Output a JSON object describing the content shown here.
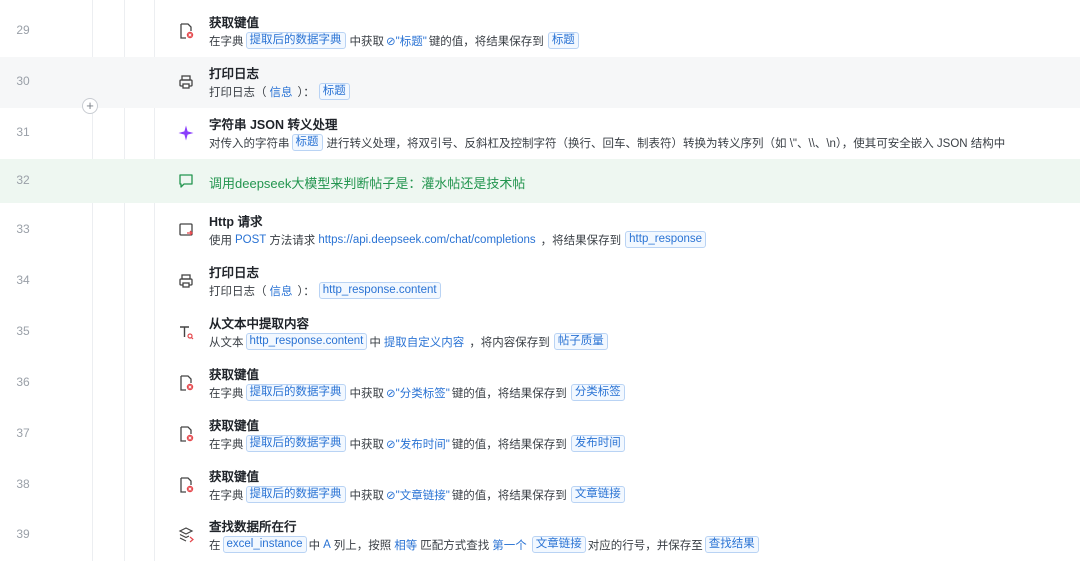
{
  "rows": [
    {
      "line": "29",
      "title": "获取键值",
      "desc": [
        "在字典",
        "提取后的数据字典",
        "中获取",
        "\"标题\"",
        "键的值，将结果保存到",
        "标题"
      ]
    },
    {
      "line": "30",
      "title": "打印日志",
      "desc": [
        "打印日志（",
        "信息",
        "）：",
        "标题"
      ]
    },
    {
      "line": "31",
      "title": "字符串 JSON 转义处理",
      "desc": [
        "对传入的字符串",
        "标题",
        "进行转义处理，将双引号、反斜杠及控制字符（换行、回车、制表符）转换为转义序列（如 \\\"、\\\\、\\n），使其可安全嵌入 JSON 结构中"
      ]
    },
    {
      "line": "32",
      "comment": "调用deepseek大模型来判断帖子是：灌水帖还是技术帖"
    },
    {
      "line": "33",
      "title": "Http 请求",
      "desc": [
        "使用",
        "POST",
        "方法请求",
        "https://api.deepseek.com/chat/completions",
        "，将结果保存到",
        "http_response"
      ]
    },
    {
      "line": "34",
      "title": "打印日志",
      "desc": [
        "打印日志（",
        "信息",
        "）：",
        "http_response.content"
      ]
    },
    {
      "line": "35",
      "title": "从文本中提取内容",
      "desc": [
        "从文本",
        "http_response.content",
        "中",
        "提取自定义内容",
        "，将内容保存到",
        "帖子质量"
      ]
    },
    {
      "line": "36",
      "title": "获取键值",
      "desc": [
        "在字典",
        "提取后的数据字典",
        "中获取",
        "\"分类标签\"",
        "键的值，将结果保存到",
        "分类标签"
      ]
    },
    {
      "line": "37",
      "title": "获取键值",
      "desc": [
        "在字典",
        "提取后的数据字典",
        "中获取",
        "\"发布时间\"",
        "键的值，将结果保存到",
        "发布时间"
      ]
    },
    {
      "line": "38",
      "title": "获取键值",
      "desc": [
        "在字典",
        "提取后的数据字典",
        "中获取",
        "\"文章链接\"",
        "键的值，将结果保存到",
        "文章链接"
      ]
    },
    {
      "line": "39",
      "title": "查找数据所在行",
      "desc": [
        "在",
        "excel_instance",
        "中",
        "A",
        "列上，按照",
        "相等",
        "匹配方式查找",
        "第一个",
        "文章链接",
        "对应的行号，并保存至",
        "查找结果"
      ]
    }
  ],
  "add_button": "+",
  "icons": [
    "dict-key-icon",
    "printer-icon",
    "sparkle-icon",
    "comment-icon",
    "http-icon",
    "printer-icon",
    "text-extract-icon",
    "dict-key-icon",
    "dict-key-icon",
    "dict-key-icon",
    "find-row-icon"
  ],
  "colors": {
    "accent": "#2a73d4",
    "comment": "#23954f",
    "sparkle": "#8a3ffc",
    "danger": "#e5484d"
  }
}
